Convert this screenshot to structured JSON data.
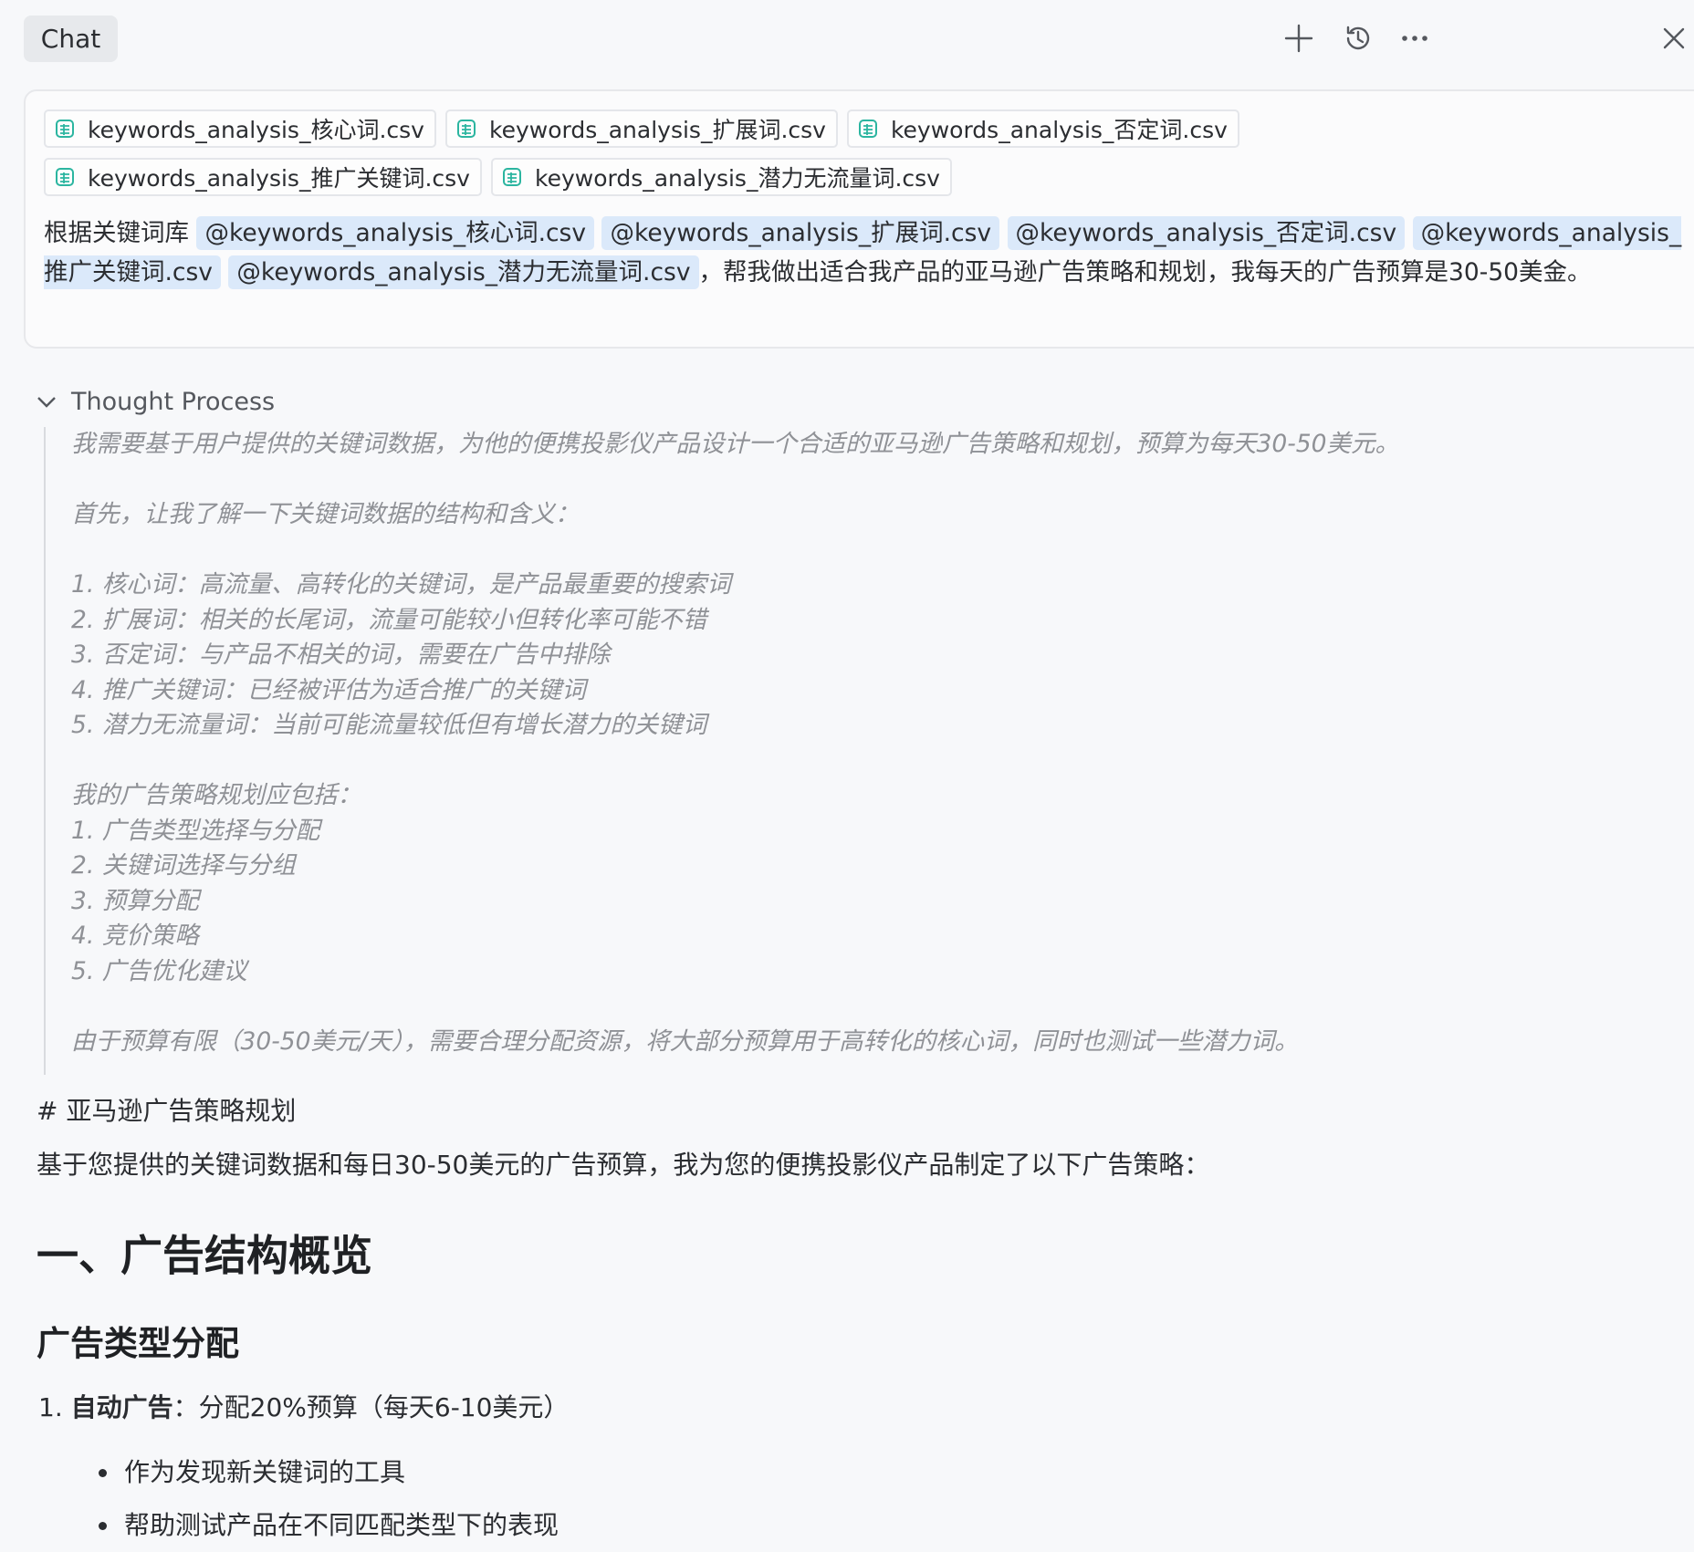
{
  "header": {
    "tab_label": "Chat",
    "icons": [
      "plus-icon",
      "history-icon",
      "more-icon",
      "close-icon"
    ]
  },
  "attachments": [
    "keywords_analysis_核心词.csv",
    "keywords_analysis_扩展词.csv",
    "keywords_analysis_否定词.csv",
    "keywords_analysis_推广关键词.csv",
    "keywords_analysis_潜力无流量词.csv"
  ],
  "prompt": {
    "prefix": "根据关键词库",
    "mentions": [
      "@keywords_analysis_核心词.csv",
      "@keywords_analysis_扩展词.csv",
      "@keywords_analysis_否定词.csv",
      "@keywords_analysis_推广关键词.csv",
      "@keywords_analysis_潜力无流量词.csv"
    ],
    "suffix": "，帮我做出适合我产品的亚马逊广告策略和规划，我每天的广告预算是30-50美金。"
  },
  "thought": {
    "label": "Thought Process",
    "lines": [
      "我需要基于用户提供的关键词数据，为他的便携投影仪产品设计一个合适的亚马逊广告策略和规划，预算为每天30-50美元。",
      "",
      "首先，让我了解一下关键词数据的结构和含义：",
      "",
      "1. 核心词：高流量、高转化的关键词，是产品最重要的搜索词",
      "2. 扩展词：相关的长尾词，流量可能较小但转化率可能不错",
      "3. 否定词：与产品不相关的词，需要在广告中排除",
      "4. 推广关键词：已经被评估为适合推广的关键词",
      "5. 潜力无流量词：当前可能流量较低但有增长潜力的关键词",
      "",
      "我的广告策略规划应包括：",
      "1. 广告类型选择与分配",
      "2. 关键词选择与分组",
      "3. 预算分配",
      "4. 竞价策略",
      "5. 广告优化建议",
      "",
      "由于预算有限（30-50美元/天），需要合理分配资源，将大部分预算用于高转化的核心词，同时也测试一些潜力词。"
    ]
  },
  "response": {
    "h1": "# 亚马逊广告策略规划",
    "intro": "基于您提供的关键词数据和每日30-50美元的广告预算，我为您的便携投影仪产品制定了以下广告策略：",
    "section_title": "一、广告结构概览",
    "subsection_title": "广告类型分配",
    "item1_number": "1.",
    "item1_bold": "自动广告",
    "item1_text": "：分配20%预算（每天6-10美元）",
    "bullets": [
      "作为发现新关键词的工具",
      "帮助测试产品在不同匹配类型下的表现"
    ]
  }
}
